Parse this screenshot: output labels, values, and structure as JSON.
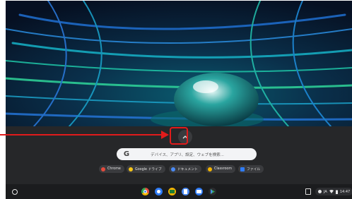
{
  "launcher": {
    "search_placeholder": "デバイス、アプリ、設定、ウェブを検索...",
    "google_glyph": "G",
    "expand_icon": "chevron-up-icon",
    "chips": [
      {
        "label": "Chrome",
        "icon": "chrome-icon",
        "color": "#e34b3d"
      },
      {
        "label": "Google ドライブ",
        "icon": "google-drive-icon",
        "color": "#f5c518"
      },
      {
        "label": "ドキュメント",
        "icon": "google-docs-icon",
        "color": "#4a8af4"
      },
      {
        "label": "Classroom",
        "icon": "google-classroom-icon",
        "color": "#f4b400"
      },
      {
        "label": "ファイル",
        "icon": "files-icon",
        "color": "#2f7cf6"
      }
    ]
  },
  "shelf": {
    "apps": [
      {
        "name": "chrome-icon",
        "color": "#e34b3d"
      },
      {
        "name": "camera-icon",
        "color": "#2f7cf6"
      },
      {
        "name": "google-classroom-icon",
        "color": "#f4b400"
      },
      {
        "name": "google-docs-icon",
        "color": "#4a8af4"
      },
      {
        "name": "files-icon",
        "color": "#2f7cf6"
      },
      {
        "name": "play-store-icon",
        "color": "#34a853"
      }
    ],
    "status": {
      "language": "JA",
      "time": "14:47"
    }
  },
  "annotation": {
    "color": "#e11b1b"
  }
}
